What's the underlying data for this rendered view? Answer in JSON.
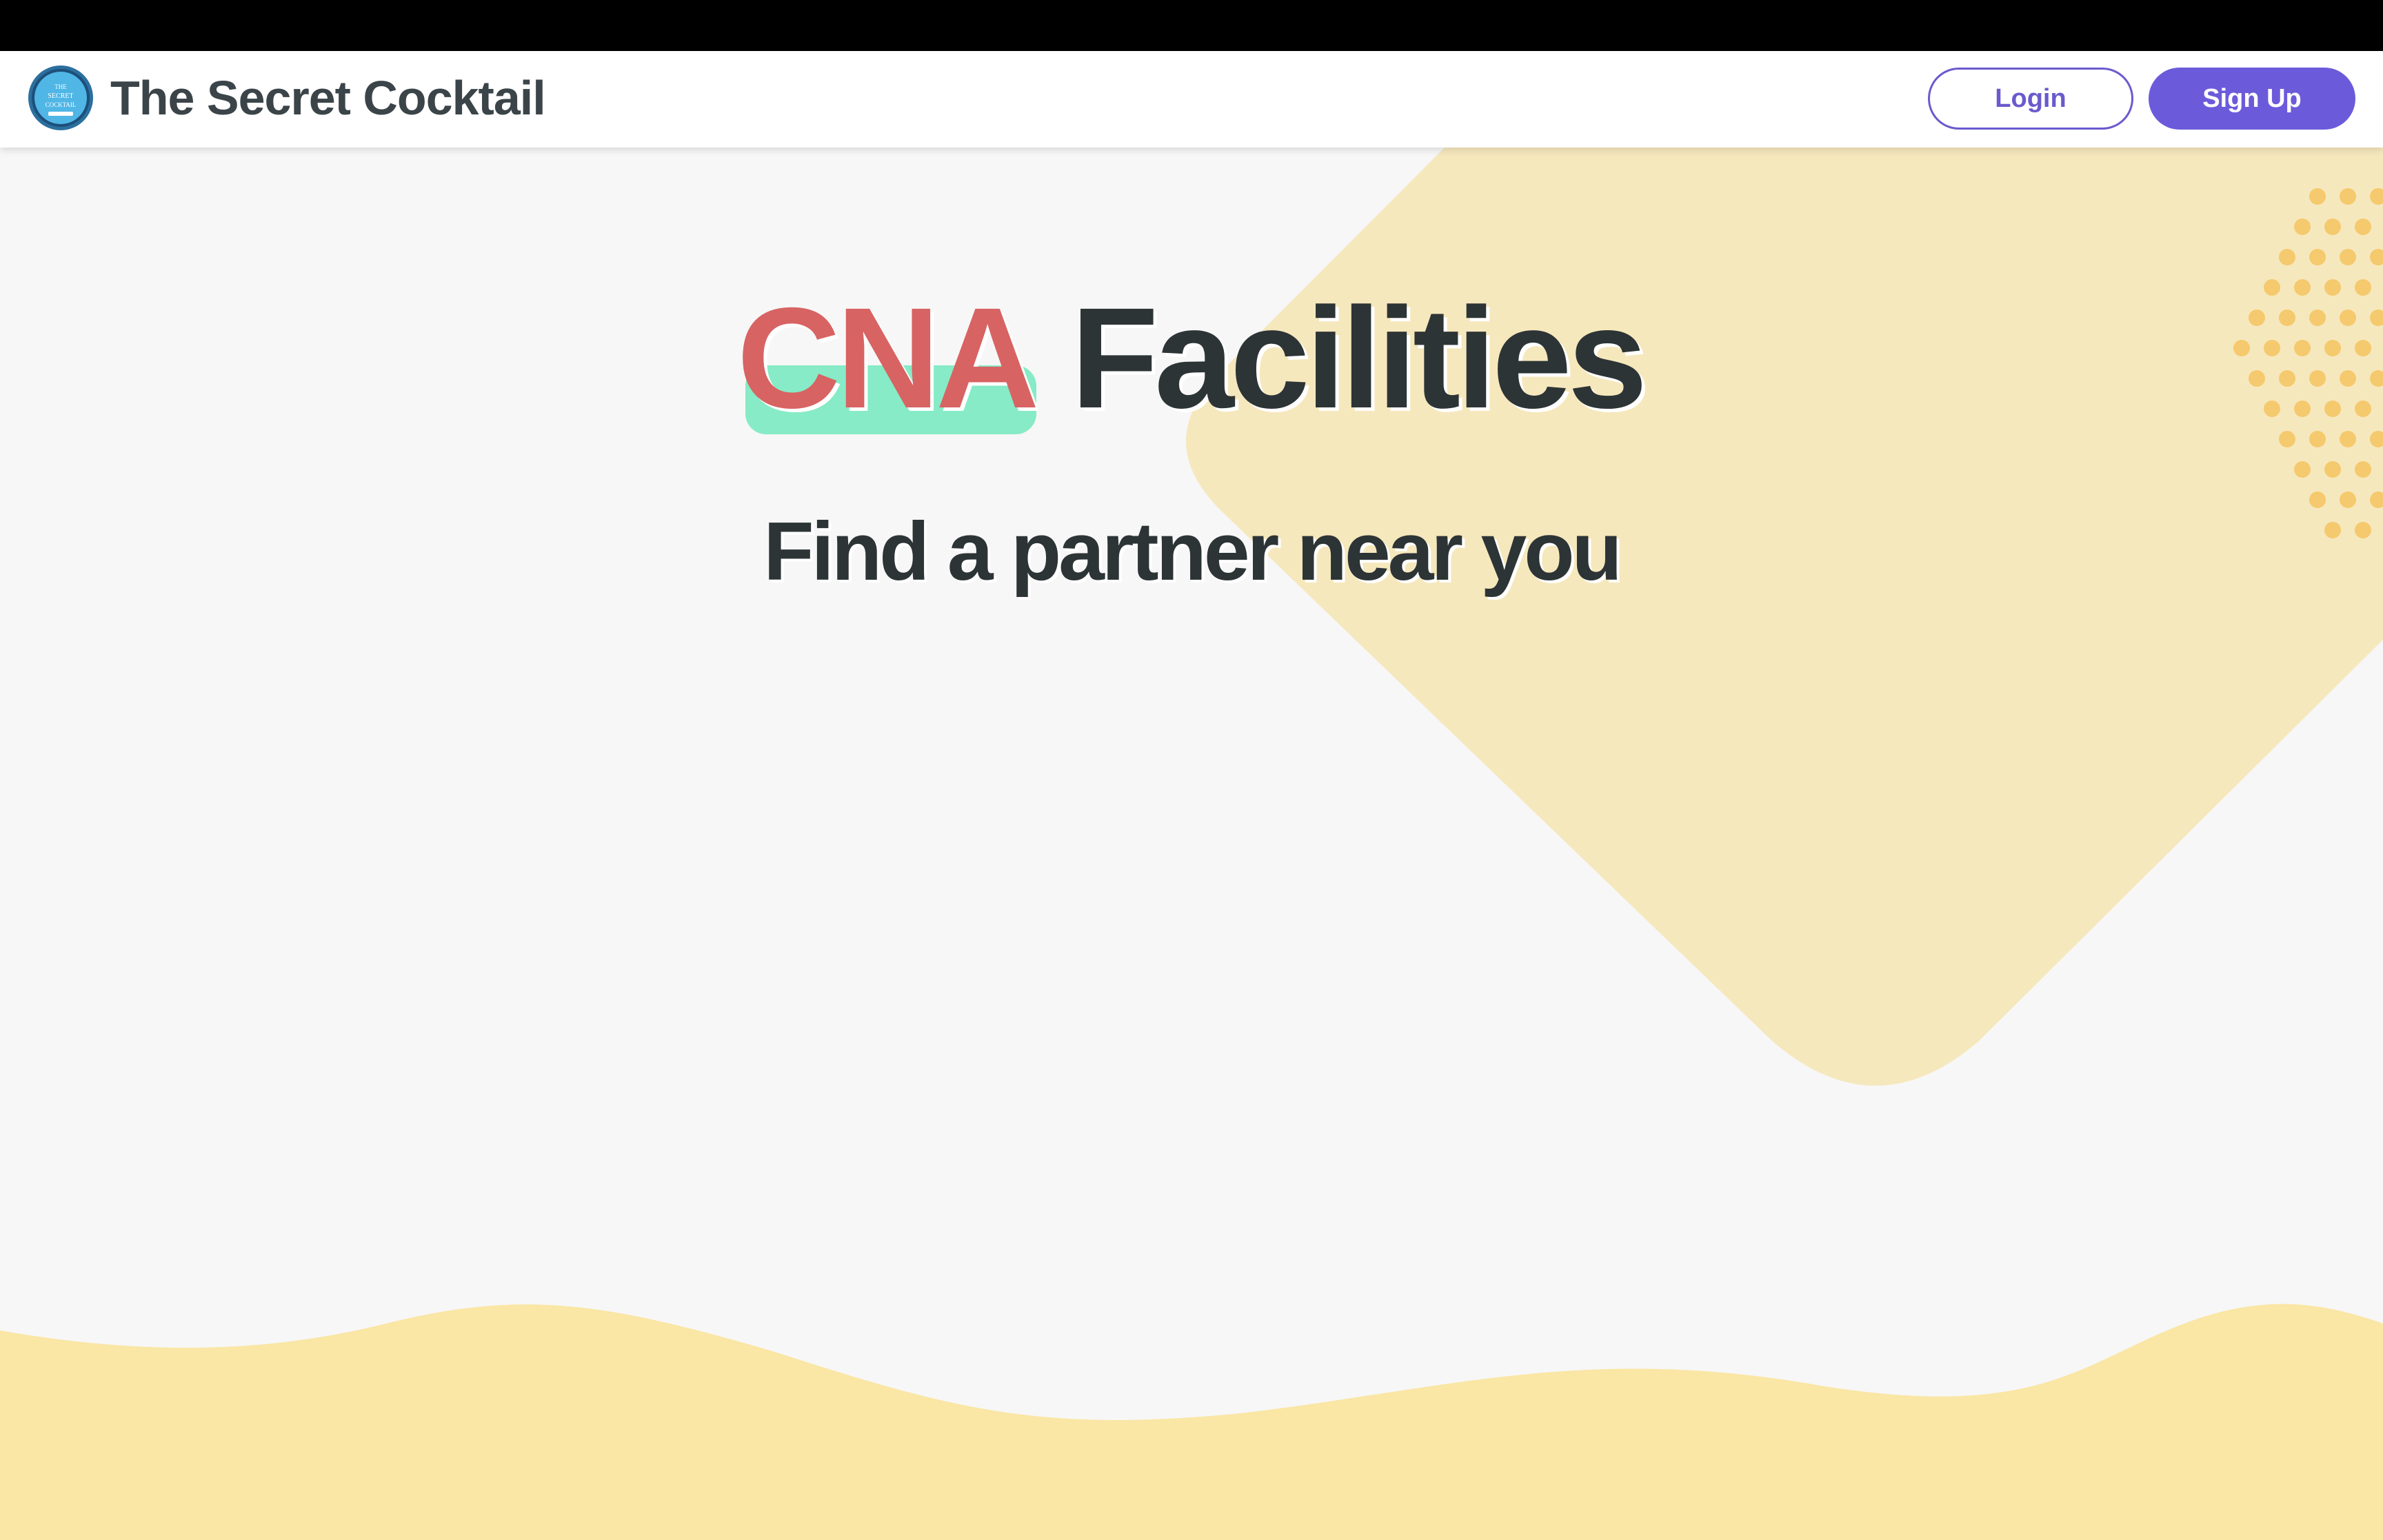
{
  "navbar": {
    "brand_name": "The Secret Cocktail",
    "logo_text": [
      "THE",
      "SECRET",
      "COCKTAIL"
    ],
    "login_label": "Login",
    "signup_label": "Sign Up"
  },
  "hero": {
    "title_highlight": "CNA",
    "title_rest": "Facilities",
    "subtitle": "Find a partner near you"
  },
  "colors": {
    "top_bar": "#000000",
    "page_background": "#f7f7f7",
    "accent_purple": "#6b5bdb",
    "highlight_red": "#d86363",
    "highlight_mint": "#86ebc6",
    "decor_yellow": "#f6e8bd",
    "wave_yellow": "#fae6a5",
    "dot_orange": "#f5c96d",
    "title_dark": "#2d3436"
  }
}
